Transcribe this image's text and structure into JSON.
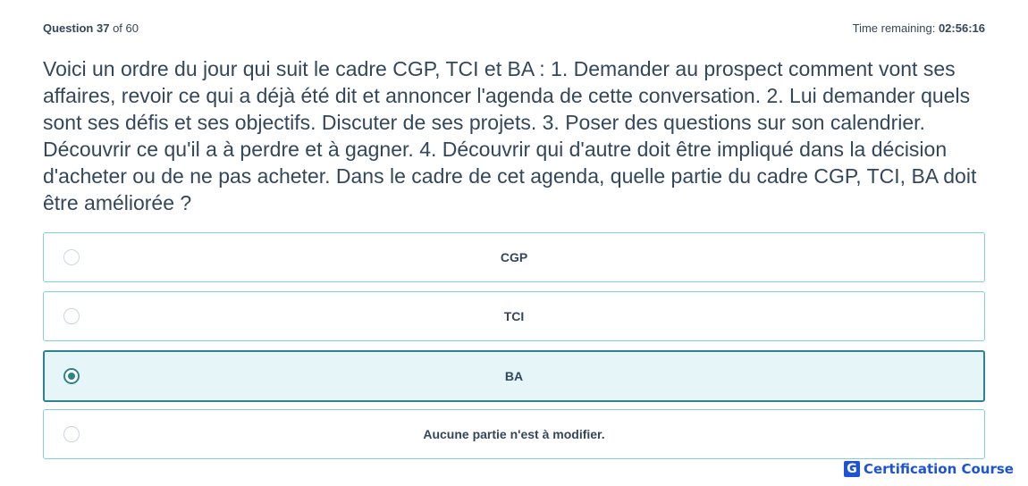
{
  "header": {
    "question_label": "Question",
    "question_number": "37",
    "question_of": "of 60",
    "time_label": "Time remaining:",
    "time_value": "02:56:16"
  },
  "question": {
    "text": "Voici un ordre du jour qui suit le cadre CGP, TCI et BA : 1. Demander au prospect comment vont ses affaires, revoir ce qui a déjà été dit et annoncer l'agenda de cette conversation. 2. Lui demander quels sont ses défis et ses objectifs. Discuter de ses projets. 3. Poser des questions sur son calendrier. Découvrir ce qu'il a à perdre et à gagner. 4. Découvrir qui d'autre doit être impliqué dans la décision d'acheter ou de ne pas acheter. Dans le cadre de cet agenda, quelle partie du cadre CGP, TCI, BA doit être améliorée ?"
  },
  "options": [
    {
      "label": "CGP",
      "selected": false
    },
    {
      "label": "TCI",
      "selected": false
    },
    {
      "label": "BA",
      "selected": true
    },
    {
      "label": "Aucune partie n'est à modifier.",
      "selected": false
    }
  ],
  "brand": {
    "icon_letter": "G",
    "name": "Certification Course",
    "color": "#1d53d6"
  },
  "colors": {
    "text": "#33475b",
    "option_border": "#7fd1de",
    "selected_border": "#2f8391",
    "selected_bg": "#e5f5f8"
  }
}
